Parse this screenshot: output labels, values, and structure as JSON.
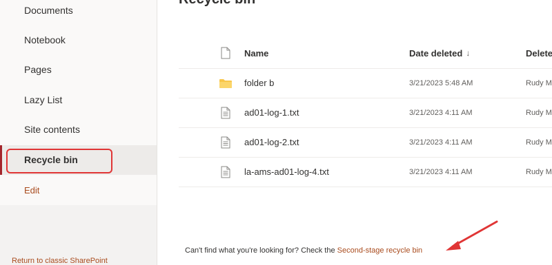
{
  "nav": {
    "items": [
      {
        "label": "Documents"
      },
      {
        "label": "Notebook"
      },
      {
        "label": "Pages"
      },
      {
        "label": "Lazy List"
      },
      {
        "label": "Site contents"
      },
      {
        "label": "Recycle bin"
      },
      {
        "label": "Edit"
      }
    ],
    "return_link": "Return to classic SharePoint"
  },
  "main": {
    "title": "Recycle bin",
    "columns": {
      "name": "Name",
      "date_deleted": "Date deleted",
      "sort_indicator": "↓",
      "deleted_by": "Delete"
    },
    "rows": [
      {
        "type": "folder",
        "name": "folder b",
        "date": "3/21/2023 5:48 AM",
        "by": "Rudy M"
      },
      {
        "type": "file",
        "name": "ad01-log-1.txt",
        "date": "3/21/2023 4:11 AM",
        "by": "Rudy M"
      },
      {
        "type": "file",
        "name": "ad01-log-2.txt",
        "date": "3/21/2023 4:11 AM",
        "by": "Rudy M"
      },
      {
        "type": "file",
        "name": "la-ams-ad01-log-4.txt",
        "date": "3/21/2023 4:11 AM",
        "by": "Rudy M"
      }
    ],
    "footer": {
      "prompt": "Can't find what you're looking for? Check the ",
      "link": "Second-stage recycle bin"
    }
  },
  "colors": {
    "accent": "#a94b1d",
    "annotation": "#e03535",
    "folder": "#f8c64a"
  }
}
